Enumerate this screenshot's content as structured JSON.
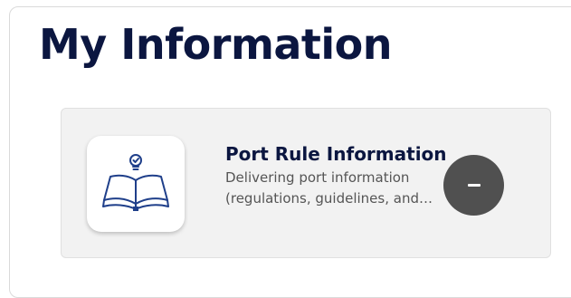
{
  "page": {
    "title": "My Information"
  },
  "card": {
    "title": "Port Rule Information",
    "description": "Delivering port information (regulations, guidelines, and more)",
    "icon": "open-book-lightbulb-icon",
    "button_icon": "minus-icon"
  },
  "colors": {
    "title": "#0b1640",
    "card_background": "#f2f2f2",
    "icon_stroke": "#1f3f8a",
    "button_background": "#505050"
  }
}
